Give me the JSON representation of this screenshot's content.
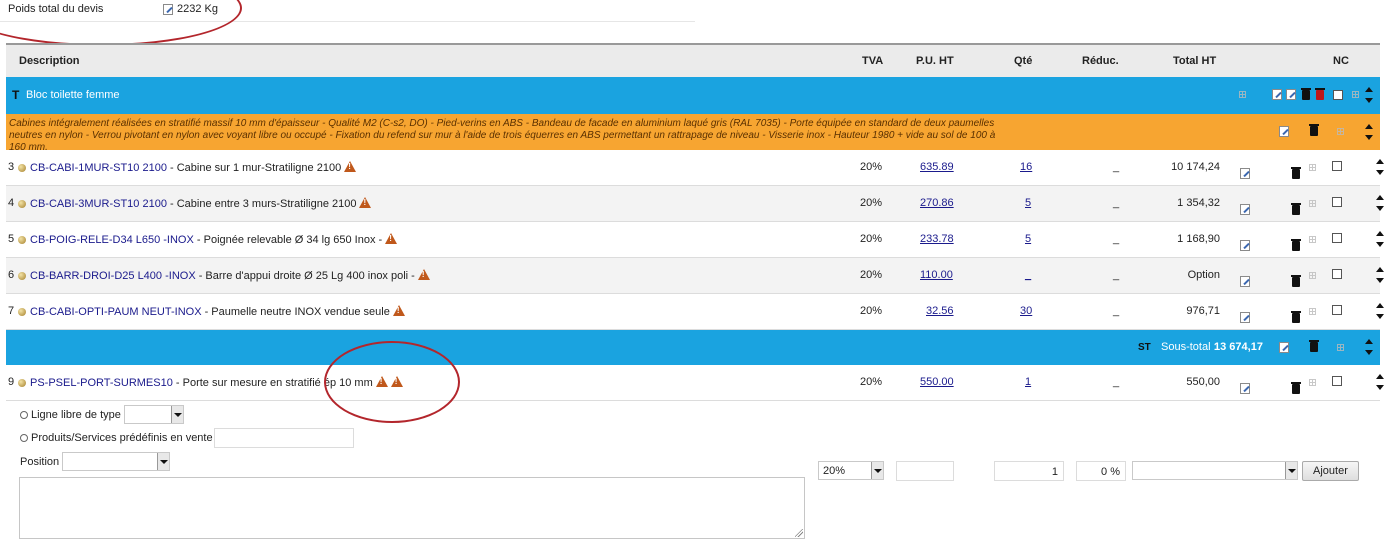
{
  "header": {
    "weight_label": "Poids total du devis",
    "weight_value": "2232 Kg"
  },
  "table": {
    "columns": {
      "description": "Description",
      "tva": "TVA",
      "pu_ht": "P.U. HT",
      "qte": "Qté",
      "reduc": "Réduc.",
      "total_ht": "Total HT",
      "nc": "NC"
    },
    "section_title": "Bloc toilette femme",
    "section_note": "Cabines intégralement réalisées en stratifié massif 10 mm d'épaisseur - Qualité M2 (C-s2, DO) - Pied-verins en ABS - Bandeau de facade en aluminium laqué gris (RAL 7035) - Porte équipée en standard de deux paumelles neutres en nylon - Verrou pivotant en nylon avec voyant libre ou occupé - Fixation du refend sur mur à l'aide de trois équerres en ABS permettant un rattrapage de niveau - Visserie inox - Hauteur 1980 + vide au sol de 100 à 160 mm.",
    "rows": [
      {
        "num": "3",
        "code": "CB-CABI-1MUR-ST10 2100",
        "desc": " - Cabine sur 1 mur-Stratiligne 2100",
        "tva": "20%",
        "pu": "635.89",
        "qte": "16",
        "reduc": "_",
        "total": "10 174,24"
      },
      {
        "num": "4",
        "code": "CB-CABI-3MUR-ST10 2100",
        "desc": " - Cabine entre 3 murs-Stratiligne 2100",
        "tva": "20%",
        "pu": "270.86",
        "qte": "5",
        "reduc": "_",
        "total": "1 354,32"
      },
      {
        "num": "5",
        "code": "CB-POIG-RELE-D34 L650 -INOX",
        "desc": " - Poignée relevable Ø 34 lg 650 Inox -",
        "tva": "20%",
        "pu": "233.78",
        "qte": "5",
        "reduc": "_",
        "total": "1 168,90"
      },
      {
        "num": "6",
        "code": "CB-BARR-DROI-D25 L400 -INOX",
        "desc": " - Barre d'appui droite Ø 25 Lg 400 inox poli -",
        "tva": "20%",
        "pu": "110.00",
        "qte": "_",
        "reduc": "_",
        "total": "Option"
      },
      {
        "num": "7",
        "code": "CB-CABI-OPTI-PAUM NEUT-INOX",
        "desc": " - Paumelle neutre INOX vendue seule",
        "tva": "20%",
        "pu": "32.56",
        "qte": "30",
        "reduc": "_",
        "total": "976,71"
      }
    ],
    "subtotal_icon": "ST",
    "subtotal_label": "Sous-total :",
    "subtotal_value": "13 674,17",
    "last_row": {
      "num": "9",
      "code": "PS-PSEL-PORT-SURMES10",
      "desc": " - Porte sur mesure en stratifié ép 10 mm",
      "tva": "20%",
      "pu": "550.00",
      "qte": "1",
      "reduc": "_",
      "total": "550,00"
    }
  },
  "form": {
    "radio1_label": "Ligne libre de type",
    "radio2_label": "Produits/Services prédéfinis en vente",
    "position_label": "Position",
    "tva_value": "20%",
    "qty_value": "1",
    "reduc_value": "0 %",
    "add_button": "Ajouter"
  },
  "colors": {
    "section_blue": "#1aa3e0",
    "note_orange": "#f7a531",
    "warning": "#c0581b",
    "annotation_red": "#b3262c"
  }
}
